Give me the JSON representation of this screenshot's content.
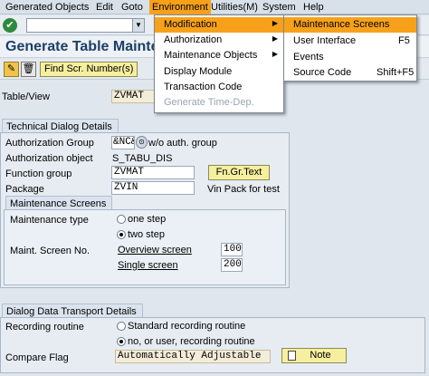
{
  "menubar": {
    "items": [
      {
        "label": "Generated Objects"
      },
      {
        "label": "Edit"
      },
      {
        "label": "Goto"
      },
      {
        "label": "Environment"
      },
      {
        "label": "Utilities(M)"
      },
      {
        "label": "System"
      },
      {
        "label": "Help"
      }
    ]
  },
  "toolbar": {
    "ok_icon": "✔",
    "command_value": ""
  },
  "title": "Generate Table Mainte",
  "app_toolbar": {
    "find_button": "Find Scr. Number(s)"
  },
  "header": {
    "table_view_label": "Table/View",
    "table_view_value": "ZVMAT"
  },
  "technical": {
    "section_title": "Technical Dialog Details",
    "auth_group_label": "Authorization Group",
    "auth_group_value": "&NC&",
    "auth_group_desc": "w/o auth. group",
    "auth_object_label": "Authorization object",
    "auth_object_value": "S_TABU_DIS",
    "function_group_label": "Function group",
    "function_group_value": "ZVMAT",
    "fn_gr_text_button": "Fn.Gr.Text",
    "package_label": "Package",
    "package_value": "ZVIN",
    "package_desc": "Vin Pack for test"
  },
  "maint": {
    "section_title": "Maintenance Screens",
    "type_label": "Maintenance type",
    "one_step": "one step",
    "two_step": "two step",
    "screen_no_label": "Maint. Screen No.",
    "overview_label": "Overview screen",
    "overview_value": "100",
    "single_label": "Single screen",
    "single_value": "200"
  },
  "transport": {
    "section_title": "Dialog Data Transport Details",
    "recording_label": "Recording routine",
    "standard_option": "Standard recording routine",
    "user_option": "no, or user, recording routine",
    "compare_label": "Compare Flag",
    "compare_value": "Automatically Adjustable",
    "note_button": "Note"
  },
  "env_menu": {
    "items": [
      {
        "label": "Modification"
      },
      {
        "label": "Authorization"
      },
      {
        "label": "Maintenance Objects"
      },
      {
        "label": "Display Module"
      },
      {
        "label": "Transaction Code"
      },
      {
        "label": "Generate Time-Dep."
      }
    ]
  },
  "mod_menu": {
    "items": [
      {
        "label": "Maintenance Screens",
        "accel": ""
      },
      {
        "label": "User Interface",
        "accel": "F5"
      },
      {
        "label": "Events",
        "accel": ""
      },
      {
        "label": "Source Code",
        "accel": "Shift+F5"
      }
    ]
  }
}
